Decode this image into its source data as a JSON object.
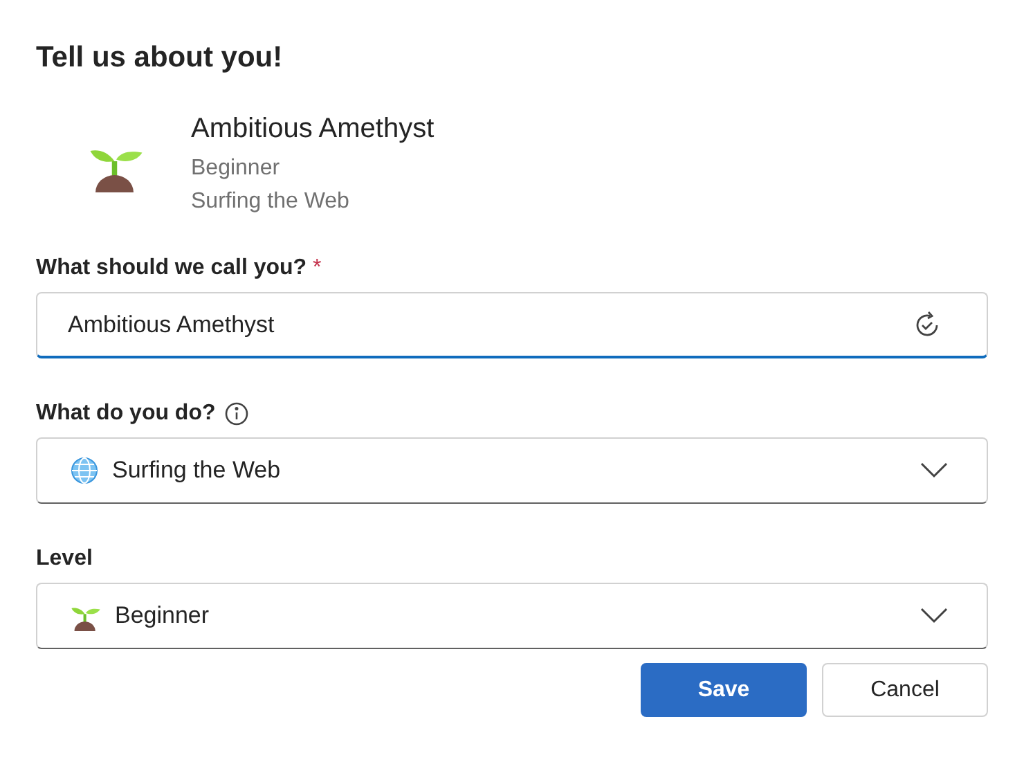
{
  "dialog": {
    "title": "Tell us about you!"
  },
  "profile": {
    "name": "Ambitious Amethyst",
    "level": "Beginner",
    "activity": "Surfing the Web"
  },
  "fields": [
    {
      "kind": "text",
      "label": "What should we call you?",
      "required_mark": "*",
      "info": false,
      "focused": true,
      "value": "Ambitious Amethyst"
    },
    {
      "kind": "select",
      "label": "What do you do?",
      "info": true,
      "focused": false,
      "value": "Surfing the Web"
    },
    {
      "kind": "select",
      "label": "Level",
      "info": false,
      "focused": false,
      "value": "Beginner"
    }
  ],
  "buttons": [
    {
      "kind": "primary",
      "label": "Save"
    },
    {
      "kind": "secondary",
      "label": "Cancel"
    }
  ]
}
